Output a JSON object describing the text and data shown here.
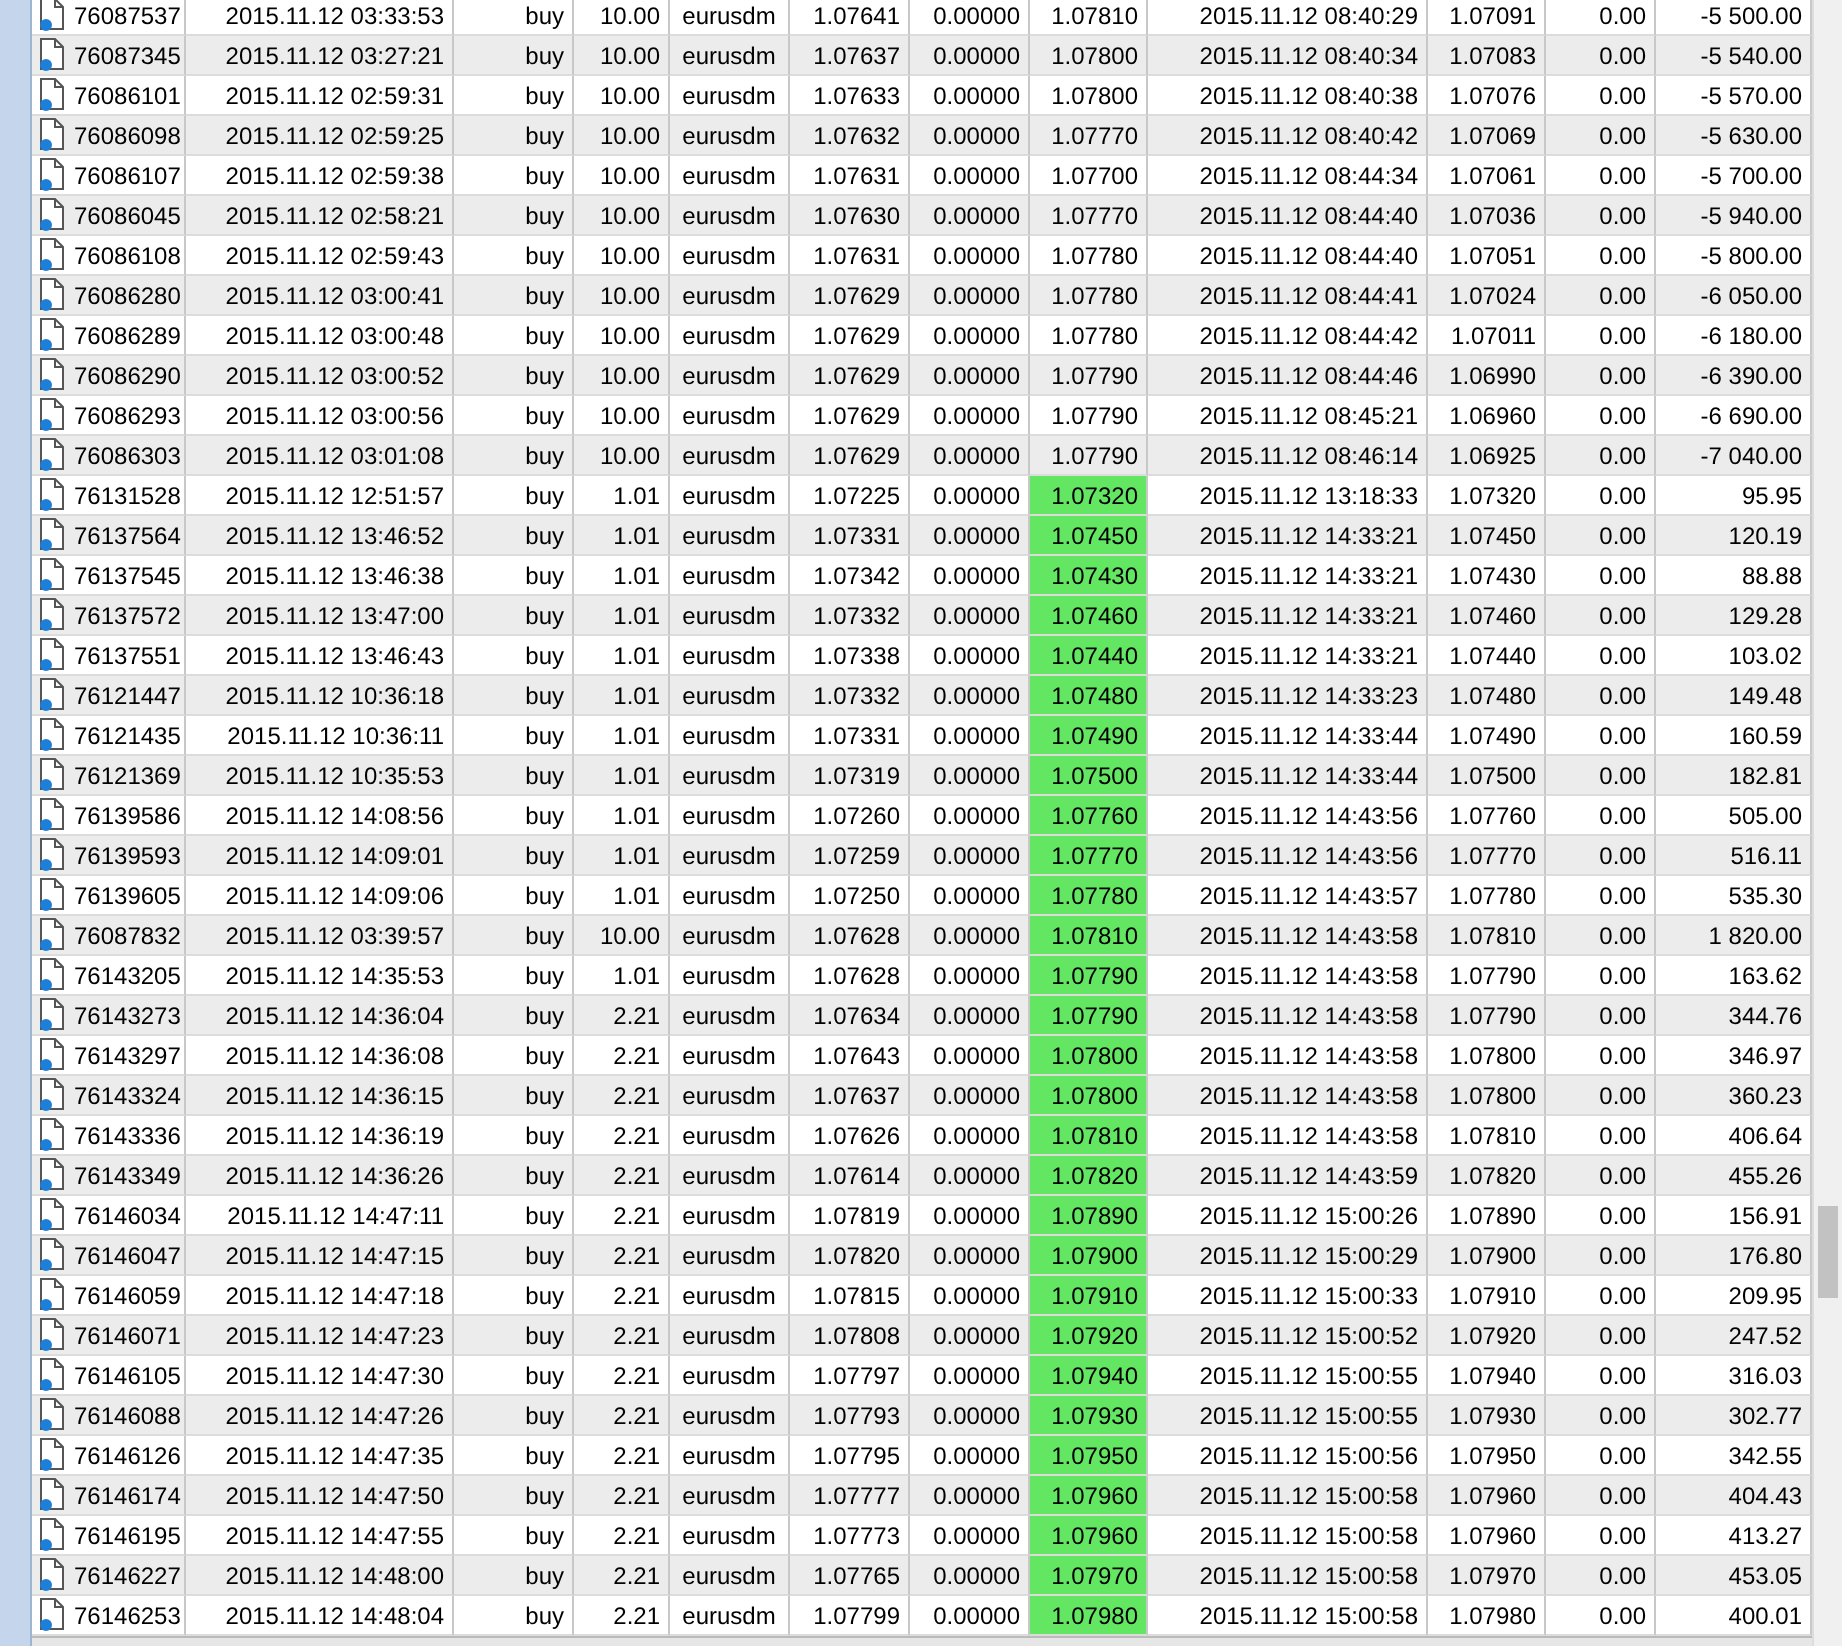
{
  "table": {
    "rows": [
      {
        "cells": [
          "76087537",
          "2015.11.12 03:33:53",
          "buy",
          "10.00",
          "eurusdm",
          "1.07641",
          "0.00000",
          "1.07810",
          "2015.11.12 08:40:29",
          "1.07091",
          "0.00",
          "-5 500.00"
        ],
        "highlighted": false
      },
      {
        "cells": [
          "76087345",
          "2015.11.12 03:27:21",
          "buy",
          "10.00",
          "eurusdm",
          "1.07637",
          "0.00000",
          "1.07800",
          "2015.11.12 08:40:34",
          "1.07083",
          "0.00",
          "-5 540.00"
        ],
        "highlighted": false
      },
      {
        "cells": [
          "76086101",
          "2015.11.12 02:59:31",
          "buy",
          "10.00",
          "eurusdm",
          "1.07633",
          "0.00000",
          "1.07800",
          "2015.11.12 08:40:38",
          "1.07076",
          "0.00",
          "-5 570.00"
        ],
        "highlighted": false
      },
      {
        "cells": [
          "76086098",
          "2015.11.12 02:59:25",
          "buy",
          "10.00",
          "eurusdm",
          "1.07632",
          "0.00000",
          "1.07770",
          "2015.11.12 08:40:42",
          "1.07069",
          "0.00",
          "-5 630.00"
        ],
        "highlighted": false
      },
      {
        "cells": [
          "76086107",
          "2015.11.12 02:59:38",
          "buy",
          "10.00",
          "eurusdm",
          "1.07631",
          "0.00000",
          "1.07700",
          "2015.11.12 08:44:34",
          "1.07061",
          "0.00",
          "-5 700.00"
        ],
        "highlighted": false
      },
      {
        "cells": [
          "76086045",
          "2015.11.12 02:58:21",
          "buy",
          "10.00",
          "eurusdm",
          "1.07630",
          "0.00000",
          "1.07770",
          "2015.11.12 08:44:40",
          "1.07036",
          "0.00",
          "-5 940.00"
        ],
        "highlighted": false
      },
      {
        "cells": [
          "76086108",
          "2015.11.12 02:59:43",
          "buy",
          "10.00",
          "eurusdm",
          "1.07631",
          "0.00000",
          "1.07780",
          "2015.11.12 08:44:40",
          "1.07051",
          "0.00",
          "-5 800.00"
        ],
        "highlighted": false
      },
      {
        "cells": [
          "76086280",
          "2015.11.12 03:00:41",
          "buy",
          "10.00",
          "eurusdm",
          "1.07629",
          "0.00000",
          "1.07780",
          "2015.11.12 08:44:41",
          "1.07024",
          "0.00",
          "-6 050.00"
        ],
        "highlighted": false
      },
      {
        "cells": [
          "76086289",
          "2015.11.12 03:00:48",
          "buy",
          "10.00",
          "eurusdm",
          "1.07629",
          "0.00000",
          "1.07780",
          "2015.11.12 08:44:42",
          "1.07011",
          "0.00",
          "-6 180.00"
        ],
        "highlighted": false
      },
      {
        "cells": [
          "76086290",
          "2015.11.12 03:00:52",
          "buy",
          "10.00",
          "eurusdm",
          "1.07629",
          "0.00000",
          "1.07790",
          "2015.11.12 08:44:46",
          "1.06990",
          "0.00",
          "-6 390.00"
        ],
        "highlighted": false
      },
      {
        "cells": [
          "76086293",
          "2015.11.12 03:00:56",
          "buy",
          "10.00",
          "eurusdm",
          "1.07629",
          "0.00000",
          "1.07790",
          "2015.11.12 08:45:21",
          "1.06960",
          "0.00",
          "-6 690.00"
        ],
        "highlighted": false
      },
      {
        "cells": [
          "76086303",
          "2015.11.12 03:01:08",
          "buy",
          "10.00",
          "eurusdm",
          "1.07629",
          "0.00000",
          "1.07790",
          "2015.11.12 08:46:14",
          "1.06925",
          "0.00",
          "-7 040.00"
        ],
        "highlighted": false
      },
      {
        "cells": [
          "76131528",
          "2015.11.12 12:51:57",
          "buy",
          "1.01",
          "eurusdm",
          "1.07225",
          "0.00000",
          "1.07320",
          "2015.11.12 13:18:33",
          "1.07320",
          "0.00",
          "95.95"
        ],
        "highlighted": true
      },
      {
        "cells": [
          "76137564",
          "2015.11.12 13:46:52",
          "buy",
          "1.01",
          "eurusdm",
          "1.07331",
          "0.00000",
          "1.07450",
          "2015.11.12 14:33:21",
          "1.07450",
          "0.00",
          "120.19"
        ],
        "highlighted": true
      },
      {
        "cells": [
          "76137545",
          "2015.11.12 13:46:38",
          "buy",
          "1.01",
          "eurusdm",
          "1.07342",
          "0.00000",
          "1.07430",
          "2015.11.12 14:33:21",
          "1.07430",
          "0.00",
          "88.88"
        ],
        "highlighted": true
      },
      {
        "cells": [
          "76137572",
          "2015.11.12 13:47:00",
          "buy",
          "1.01",
          "eurusdm",
          "1.07332",
          "0.00000",
          "1.07460",
          "2015.11.12 14:33:21",
          "1.07460",
          "0.00",
          "129.28"
        ],
        "highlighted": true
      },
      {
        "cells": [
          "76137551",
          "2015.11.12 13:46:43",
          "buy",
          "1.01",
          "eurusdm",
          "1.07338",
          "0.00000",
          "1.07440",
          "2015.11.12 14:33:21",
          "1.07440",
          "0.00",
          "103.02"
        ],
        "highlighted": true
      },
      {
        "cells": [
          "76121447",
          "2015.11.12 10:36:18",
          "buy",
          "1.01",
          "eurusdm",
          "1.07332",
          "0.00000",
          "1.07480",
          "2015.11.12 14:33:23",
          "1.07480",
          "0.00",
          "149.48"
        ],
        "highlighted": true
      },
      {
        "cells": [
          "76121435",
          "2015.11.12 10:36:11",
          "buy",
          "1.01",
          "eurusdm",
          "1.07331",
          "0.00000",
          "1.07490",
          "2015.11.12 14:33:44",
          "1.07490",
          "0.00",
          "160.59"
        ],
        "highlighted": true
      },
      {
        "cells": [
          "76121369",
          "2015.11.12 10:35:53",
          "buy",
          "1.01",
          "eurusdm",
          "1.07319",
          "0.00000",
          "1.07500",
          "2015.11.12 14:33:44",
          "1.07500",
          "0.00",
          "182.81"
        ],
        "highlighted": true
      },
      {
        "cells": [
          "76139586",
          "2015.11.12 14:08:56",
          "buy",
          "1.01",
          "eurusdm",
          "1.07260",
          "0.00000",
          "1.07760",
          "2015.11.12 14:43:56",
          "1.07760",
          "0.00",
          "505.00"
        ],
        "highlighted": true
      },
      {
        "cells": [
          "76139593",
          "2015.11.12 14:09:01",
          "buy",
          "1.01",
          "eurusdm",
          "1.07259",
          "0.00000",
          "1.07770",
          "2015.11.12 14:43:56",
          "1.07770",
          "0.00",
          "516.11"
        ],
        "highlighted": true
      },
      {
        "cells": [
          "76139605",
          "2015.11.12 14:09:06",
          "buy",
          "1.01",
          "eurusdm",
          "1.07250",
          "0.00000",
          "1.07780",
          "2015.11.12 14:43:57",
          "1.07780",
          "0.00",
          "535.30"
        ],
        "highlighted": true
      },
      {
        "cells": [
          "76087832",
          "2015.11.12 03:39:57",
          "buy",
          "10.00",
          "eurusdm",
          "1.07628",
          "0.00000",
          "1.07810",
          "2015.11.12 14:43:58",
          "1.07810",
          "0.00",
          "1 820.00"
        ],
        "highlighted": true
      },
      {
        "cells": [
          "76143205",
          "2015.11.12 14:35:53",
          "buy",
          "1.01",
          "eurusdm",
          "1.07628",
          "0.00000",
          "1.07790",
          "2015.11.12 14:43:58",
          "1.07790",
          "0.00",
          "163.62"
        ],
        "highlighted": true
      },
      {
        "cells": [
          "76143273",
          "2015.11.12 14:36:04",
          "buy",
          "2.21",
          "eurusdm",
          "1.07634",
          "0.00000",
          "1.07790",
          "2015.11.12 14:43:58",
          "1.07790",
          "0.00",
          "344.76"
        ],
        "highlighted": true
      },
      {
        "cells": [
          "76143297",
          "2015.11.12 14:36:08",
          "buy",
          "2.21",
          "eurusdm",
          "1.07643",
          "0.00000",
          "1.07800",
          "2015.11.12 14:43:58",
          "1.07800",
          "0.00",
          "346.97"
        ],
        "highlighted": true
      },
      {
        "cells": [
          "76143324",
          "2015.11.12 14:36:15",
          "buy",
          "2.21",
          "eurusdm",
          "1.07637",
          "0.00000",
          "1.07800",
          "2015.11.12 14:43:58",
          "1.07800",
          "0.00",
          "360.23"
        ],
        "highlighted": true
      },
      {
        "cells": [
          "76143336",
          "2015.11.12 14:36:19",
          "buy",
          "2.21",
          "eurusdm",
          "1.07626",
          "0.00000",
          "1.07810",
          "2015.11.12 14:43:58",
          "1.07810",
          "0.00",
          "406.64"
        ],
        "highlighted": true
      },
      {
        "cells": [
          "76143349",
          "2015.11.12 14:36:26",
          "buy",
          "2.21",
          "eurusdm",
          "1.07614",
          "0.00000",
          "1.07820",
          "2015.11.12 14:43:59",
          "1.07820",
          "0.00",
          "455.26"
        ],
        "highlighted": true
      },
      {
        "cells": [
          "76146034",
          "2015.11.12 14:47:11",
          "buy",
          "2.21",
          "eurusdm",
          "1.07819",
          "0.00000",
          "1.07890",
          "2015.11.12 15:00:26",
          "1.07890",
          "0.00",
          "156.91"
        ],
        "highlighted": true
      },
      {
        "cells": [
          "76146047",
          "2015.11.12 14:47:15",
          "buy",
          "2.21",
          "eurusdm",
          "1.07820",
          "0.00000",
          "1.07900",
          "2015.11.12 15:00:29",
          "1.07900",
          "0.00",
          "176.80"
        ],
        "highlighted": true
      },
      {
        "cells": [
          "76146059",
          "2015.11.12 14:47:18",
          "buy",
          "2.21",
          "eurusdm",
          "1.07815",
          "0.00000",
          "1.07910",
          "2015.11.12 15:00:33",
          "1.07910",
          "0.00",
          "209.95"
        ],
        "highlighted": true
      },
      {
        "cells": [
          "76146071",
          "2015.11.12 14:47:23",
          "buy",
          "2.21",
          "eurusdm",
          "1.07808",
          "0.00000",
          "1.07920",
          "2015.11.12 15:00:52",
          "1.07920",
          "0.00",
          "247.52"
        ],
        "highlighted": true
      },
      {
        "cells": [
          "76146105",
          "2015.11.12 14:47:30",
          "buy",
          "2.21",
          "eurusdm",
          "1.07797",
          "0.00000",
          "1.07940",
          "2015.11.12 15:00:55",
          "1.07940",
          "0.00",
          "316.03"
        ],
        "highlighted": true
      },
      {
        "cells": [
          "76146088",
          "2015.11.12 14:47:26",
          "buy",
          "2.21",
          "eurusdm",
          "1.07793",
          "0.00000",
          "1.07930",
          "2015.11.12 15:00:55",
          "1.07930",
          "0.00",
          "302.77"
        ],
        "highlighted": true
      },
      {
        "cells": [
          "76146126",
          "2015.11.12 14:47:35",
          "buy",
          "2.21",
          "eurusdm",
          "1.07795",
          "0.00000",
          "1.07950",
          "2015.11.12 15:00:56",
          "1.07950",
          "0.00",
          "342.55"
        ],
        "highlighted": true
      },
      {
        "cells": [
          "76146174",
          "2015.11.12 14:47:50",
          "buy",
          "2.21",
          "eurusdm",
          "1.07777",
          "0.00000",
          "1.07960",
          "2015.11.12 15:00:58",
          "1.07960",
          "0.00",
          "404.43"
        ],
        "highlighted": true
      },
      {
        "cells": [
          "76146195",
          "2015.11.12 14:47:55",
          "buy",
          "2.21",
          "eurusdm",
          "1.07773",
          "0.00000",
          "1.07960",
          "2015.11.12 15:00:58",
          "1.07960",
          "0.00",
          "413.27"
        ],
        "highlighted": true
      },
      {
        "cells": [
          "76146227",
          "2015.11.12 14:48:00",
          "buy",
          "2.21",
          "eurusdm",
          "1.07765",
          "0.00000",
          "1.07970",
          "2015.11.12 15:00:58",
          "1.07970",
          "0.00",
          "453.05"
        ],
        "highlighted": true
      },
      {
        "cells": [
          "76146253",
          "2015.11.12 14:48:04",
          "buy",
          "2.21",
          "eurusdm",
          "1.07799",
          "0.00000",
          "1.07980",
          "2015.11.12 15:00:58",
          "1.07980",
          "0.00",
          "400.01"
        ],
        "highlighted": true
      }
    ]
  }
}
